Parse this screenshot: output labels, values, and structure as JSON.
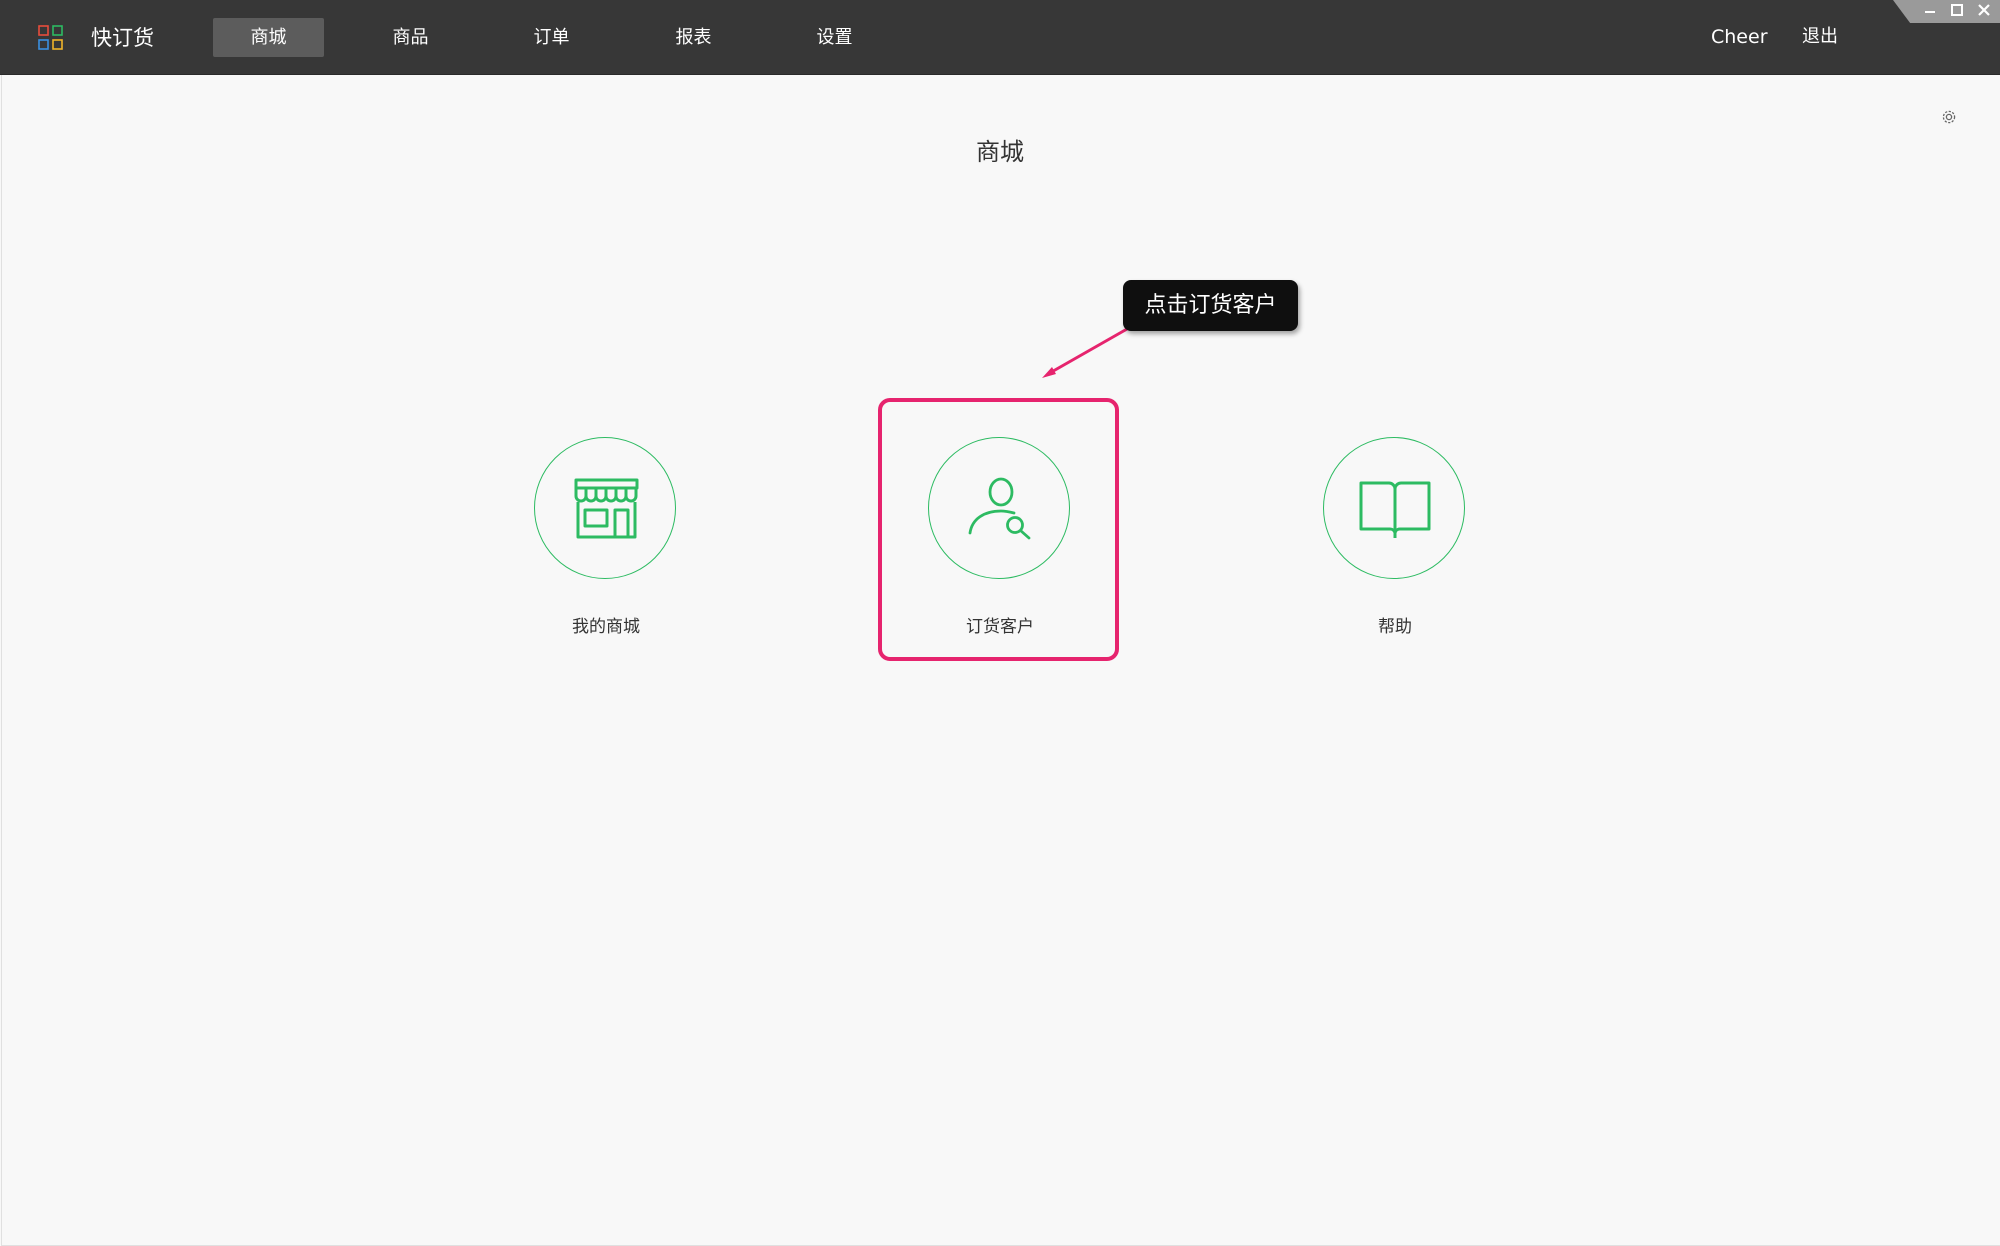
{
  "app": {
    "name": "快订货",
    "logo_icon": "grid-logo-icon"
  },
  "nav": {
    "items": [
      {
        "label": "商城",
        "active": true
      },
      {
        "label": "商品",
        "active": false
      },
      {
        "label": "订单",
        "active": false
      },
      {
        "label": "报表",
        "active": false
      },
      {
        "label": "设置",
        "active": false
      }
    ]
  },
  "user": {
    "name": "Cheer",
    "logout_label": "退出"
  },
  "window_controls": {
    "minimize": "minimize-icon",
    "maximize": "maximize-icon",
    "close": "close-icon"
  },
  "page": {
    "title": "商城",
    "settings_icon": "gear-icon"
  },
  "tiles": [
    {
      "label": "我的商城",
      "icon": "storefront-icon"
    },
    {
      "label": "订货客户",
      "icon": "user-search-icon"
    },
    {
      "label": "帮助",
      "icon": "book-icon"
    }
  ],
  "annotation": {
    "callout_text": "点击订货客户",
    "highlight_color": "#e6246e"
  },
  "colors": {
    "accent": "#2dbb62",
    "topbar": "#373737",
    "nav_active": "#5c5c5c",
    "background": "#f8f8f8"
  }
}
